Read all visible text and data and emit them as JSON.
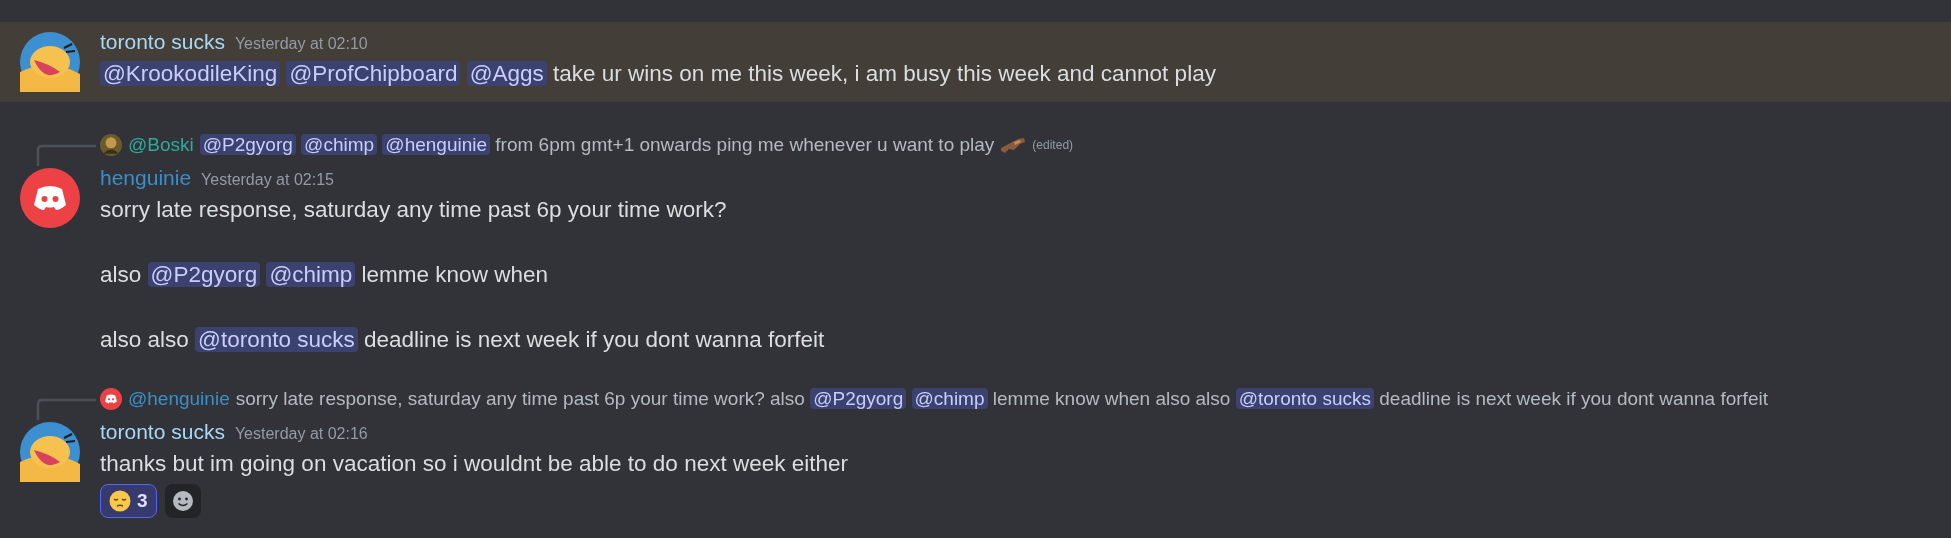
{
  "messages": [
    {
      "highlighted": true,
      "avatar": {
        "kind": "cartoon"
      },
      "author": "toronto sucks",
      "color": "#a9d8f5",
      "timestamp": "Yesterday at 02:10",
      "paragraphs": [
        [
          {
            "kind": "mention",
            "text": "@KrookodileKing"
          },
          {
            "kind": "mention",
            "text": "@ProfChipboard"
          },
          {
            "kind": "mention",
            "text": "@Aggs"
          },
          {
            "kind": "text",
            "text": "take ur wins on me this week, i am busy this week and cannot play"
          }
        ]
      ]
    },
    {
      "highlighted": false,
      "avatar": {
        "kind": "discord"
      },
      "author": "henguinie",
      "color": "#3b8fc7",
      "timestamp": "Yesterday at 02:15",
      "reply": {
        "author": "@Boski",
        "color": "#2fa99a",
        "parts": [
          {
            "kind": "mention",
            "text": "@P2gyorg"
          },
          {
            "kind": "mention",
            "text": "@chimp"
          },
          {
            "kind": "mention",
            "text": "@henguinie"
          },
          {
            "kind": "text",
            "text": "from 6pm gmt+1 onwards ping me whenever u want to play"
          }
        ],
        "sticker": true,
        "edited": "(edited)"
      },
      "paragraphs": [
        [
          {
            "kind": "text",
            "text": "sorry late response, saturday any time past 6p your time work?"
          }
        ],
        [
          {
            "kind": "text",
            "text": "also"
          },
          {
            "kind": "mention",
            "text": "@P2gyorg"
          },
          {
            "kind": "mention",
            "text": "@chimp"
          },
          {
            "kind": "text",
            "text": "lemme know when"
          }
        ],
        [
          {
            "kind": "text",
            "text": "also also"
          },
          {
            "kind": "mention",
            "text": "@toronto sucks"
          },
          {
            "kind": "text",
            "text": "deadline is next week if you dont wanna forfeit"
          }
        ]
      ]
    },
    {
      "highlighted": false,
      "avatar": {
        "kind": "cartoon"
      },
      "author": "toronto sucks",
      "color": "#a9d8f5",
      "timestamp": "Yesterday at 02:16",
      "reply": {
        "avatar": {
          "kind": "discord"
        },
        "author": "@henguinie",
        "color": "#3b8fc7",
        "parts": [
          {
            "kind": "text",
            "text": "sorry late response, saturday any time past 6p your time work?  also"
          },
          {
            "kind": "mention",
            "text": "@P2gyorg"
          },
          {
            "kind": "mention",
            "text": "@chimp"
          },
          {
            "kind": "text",
            "text": "lemme know when  also also"
          },
          {
            "kind": "mention",
            "text": "@toronto sucks"
          },
          {
            "kind": "text",
            "text": "deadline is next week if you dont wanna forfeit"
          }
        ],
        "sticker": false
      },
      "paragraphs": [
        [
          {
            "kind": "text",
            "text": "thanks but im going on vacation so i wouldnt be able to do next week either"
          }
        ]
      ],
      "reactions": [
        {
          "count": "3",
          "selected": true
        }
      ]
    }
  ]
}
